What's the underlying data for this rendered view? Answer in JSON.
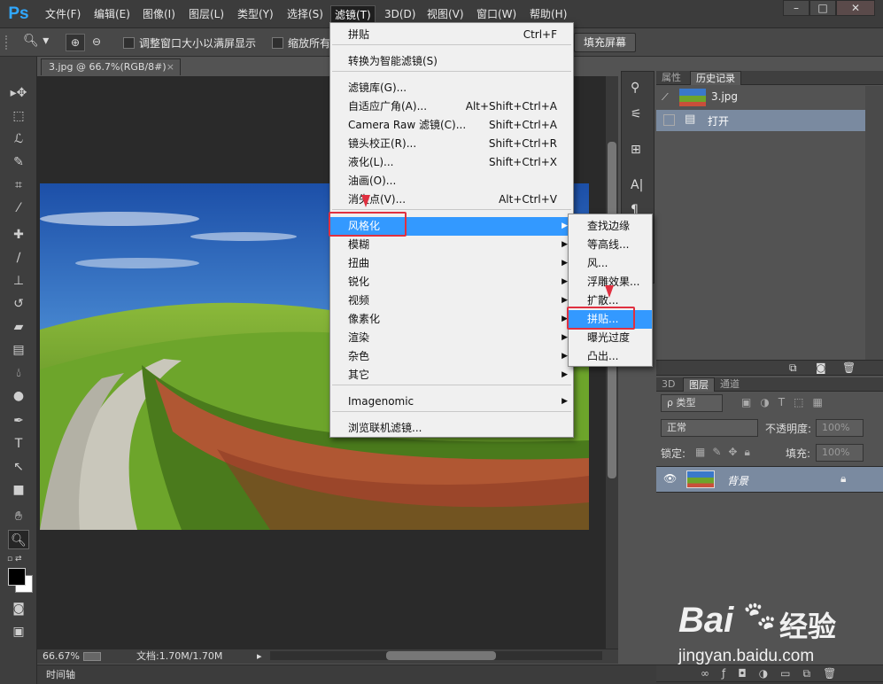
{
  "app": {
    "logo": "Ps"
  },
  "menubar": {
    "items": [
      "文件(F)",
      "编辑(E)",
      "图像(I)",
      "图层(L)",
      "类型(Y)",
      "选择(S)",
      "滤镜(T)",
      "3D(D)",
      "视图(V)",
      "窗口(W)",
      "帮助(H)"
    ],
    "active": "滤镜(T)"
  },
  "options": {
    "resize_window_label": "调整窗口大小以满屏显示",
    "zoom_all_label": "缩放所有",
    "fill_screen_label": "填充屏幕"
  },
  "document": {
    "tab_title": "3.jpg @ 66.7%(RGB/8#)",
    "close": "×"
  },
  "status": {
    "zoom": "66.67%",
    "doc_info": "文档:1.70M/1.70M"
  },
  "timeline": {
    "label": "时间轴"
  },
  "filter_menu": {
    "items": [
      {
        "label": "拼贴",
        "shortcut": "Ctrl+F"
      },
      {
        "label": "转换为智能滤镜(S)",
        "shortcut": ""
      },
      {
        "label": "滤镜库(G)...",
        "shortcut": ""
      },
      {
        "label": "自适应广角(A)...",
        "shortcut": "Alt+Shift+Ctrl+A"
      },
      {
        "label": "Camera Raw 滤镜(C)...",
        "shortcut": "Shift+Ctrl+A"
      },
      {
        "label": "镜头校正(R)...",
        "shortcut": "Shift+Ctrl+R"
      },
      {
        "label": "液化(L)...",
        "shortcut": "Shift+Ctrl+X"
      },
      {
        "label": "油画(O)...",
        "shortcut": ""
      },
      {
        "label": "消失点(V)...",
        "shortcut": "Alt+Ctrl+V"
      },
      {
        "label": "风格化",
        "shortcut": ""
      },
      {
        "label": "模糊",
        "shortcut": ""
      },
      {
        "label": "扭曲",
        "shortcut": ""
      },
      {
        "label": "锐化",
        "shortcut": ""
      },
      {
        "label": "视频",
        "shortcut": ""
      },
      {
        "label": "像素化",
        "shortcut": ""
      },
      {
        "label": "渲染",
        "shortcut": ""
      },
      {
        "label": "杂色",
        "shortcut": ""
      },
      {
        "label": "其它",
        "shortcut": ""
      },
      {
        "label": "Imagenomic",
        "shortcut": ""
      },
      {
        "label": "浏览联机滤镜...",
        "shortcut": ""
      }
    ],
    "highlighted": "风格化"
  },
  "stylize_submenu": {
    "items": [
      "查找边缘",
      "等高线...",
      "风...",
      "浮雕效果...",
      "扩散...",
      "拼贴...",
      "曝光过度",
      "凸出..."
    ],
    "highlighted": "拼贴..."
  },
  "history_panel": {
    "tabs": [
      "属性",
      "历史记录"
    ],
    "active_tab": "历史记录",
    "snapshot": "3.jpg",
    "entries": [
      "打开"
    ]
  },
  "layers_panel": {
    "tabs": [
      "3D",
      "图层",
      "通道"
    ],
    "active_tab": "图层",
    "filter_kind": "ρ 类型",
    "blend_mode": "正常",
    "opacity_label": "不透明度:",
    "opacity_value": "100%",
    "lock_label": "锁定:",
    "fill_label": "填充:",
    "fill_value": "100%",
    "layers": [
      {
        "name": "背景",
        "visible": true,
        "locked": true
      }
    ]
  },
  "watermark": {
    "brand": "Bai",
    "brand_cn": "经验",
    "domain": "jingyan.baidu.com"
  },
  "colors": {
    "menu_highlight": "#3399ff",
    "callout": "#e03040",
    "ps_blue": "#31a8ff"
  }
}
